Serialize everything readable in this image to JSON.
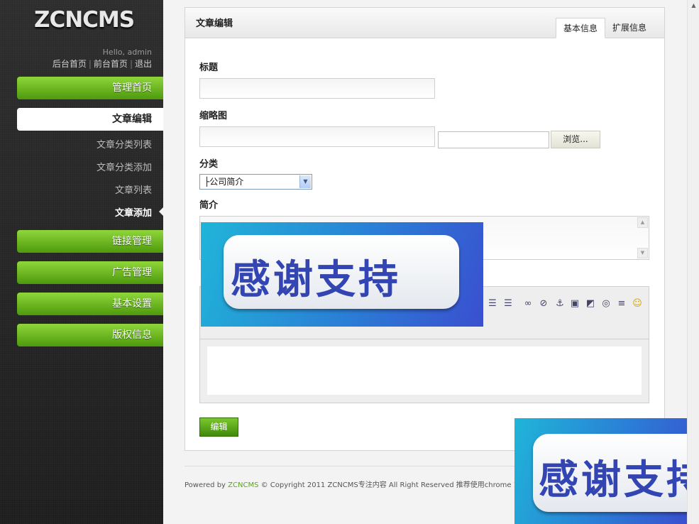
{
  "sidebar": {
    "logo": "ZCNCMS",
    "greeting": "Hello, admin",
    "top_links": [
      "后台首页",
      "前台首页",
      "退出"
    ],
    "nav": {
      "home": "管理首页",
      "article_edit": "文章编辑",
      "sub_items": [
        "文章分类列表",
        "文章分类添加",
        "文章列表",
        "文章添加"
      ],
      "links": "链接管理",
      "ads": "广告管理",
      "settings": "基本设置",
      "copyright": "版权信息"
    }
  },
  "panel": {
    "title": "文章编辑",
    "tabs": [
      "基本信息",
      "扩展信息"
    ],
    "fields": {
      "title_label": "标题",
      "title_value": "",
      "thumbnail_label": "缩略图",
      "thumbnail_value": "",
      "file_value": "",
      "browse_label": "浏览...",
      "category_label": "分类",
      "category_value": "├公司简介",
      "summary_label": "简介",
      "summary_value": ""
    },
    "submit_label": "编辑"
  },
  "footer": {
    "powered_by": "Powered by",
    "brand": "ZCNCMS",
    "copyright": "© Copyright 2011 ZCNCMS专注内容  All Right Reserved 推荐使用chrome 1"
  },
  "overlay": {
    "thanks_text": "感谢支持",
    "thanks_text_partial": "感谢支持"
  },
  "colors": {
    "nav_green": "#5aa51c",
    "sidebar_bg": "#262626",
    "banner_blue": "#2a7fd6",
    "banner_text": "#3344b3"
  }
}
